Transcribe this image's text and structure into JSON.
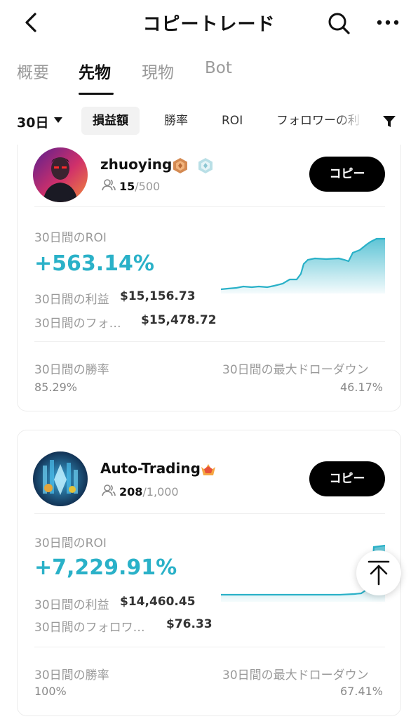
{
  "header": {
    "title": "コピートレード",
    "back_icon": "chevron-left-icon",
    "search_icon": "search-icon",
    "more_icon": "more-horizontal-icon"
  },
  "tabs": [
    {
      "label": "概要",
      "active": false
    },
    {
      "label": "先物",
      "active": true
    },
    {
      "label": "現物",
      "active": false
    },
    {
      "label": "Bot",
      "active": false
    }
  ],
  "filters": {
    "period": "30日",
    "chips": [
      {
        "label": "損益額",
        "active": true
      },
      {
        "label": "勝率",
        "active": false
      },
      {
        "label": "ROI",
        "active": false
      },
      {
        "label": "フォロワーの利",
        "active": false
      }
    ]
  },
  "colors": {
    "accent": "#2ab1c8",
    "button": "#000000"
  },
  "traders": [
    {
      "name": "zhuoying",
      "followers": "15",
      "followers_max": "/500",
      "copy_label": "コピー",
      "roi_label": "30日間のROI",
      "roi_value": "+563.14%",
      "profit_label": "30日間の利益",
      "profit_value": "$15,156.73",
      "follower_profit_label": "30日間のフォ…",
      "follower_profit_value": "$15,478.72",
      "winrate_label": "30日間の勝率",
      "winrate_value": "85.29%",
      "drawdown_label": "30日間の最大ドローダウン",
      "drawdown_value": "46.17%"
    },
    {
      "name": "Auto-Trading",
      "followers": "208",
      "followers_max": "/1,000",
      "copy_label": "コピー",
      "roi_label": "30日間のROI",
      "roi_value": "+7,229.91%",
      "profit_label": "30日間の利益",
      "profit_value": "$14,460.45",
      "follower_profit_label": "30日間のフォロワ…",
      "follower_profit_value": "$76.33",
      "winrate_label": "30日間の勝率",
      "winrate_value": "100%",
      "drawdown_label": "30日間の最大ドローダウン",
      "drawdown_value": "67.41%"
    }
  ],
  "scroll_top_icon": "arrow-up-to-top-icon"
}
